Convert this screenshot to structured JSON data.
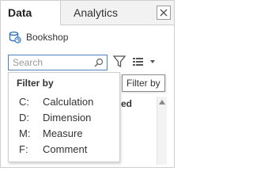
{
  "tabs": {
    "data_label": "Data",
    "analytics_label": "Analytics"
  },
  "datasource": {
    "name": "Bookshop",
    "icon": "database-refresh-icon"
  },
  "search": {
    "placeholder": "Search",
    "value": ""
  },
  "toolbar": {
    "filter_icon": "funnel-icon",
    "view_icon": "list-view-icon"
  },
  "tooltip": {
    "text": "Filter by"
  },
  "filter_menu": {
    "title": "Filter by",
    "items": [
      {
        "key": "C:",
        "label": "Calculation"
      },
      {
        "key": "D:",
        "label": "Dimension"
      },
      {
        "key": "M:",
        "label": "Measure"
      },
      {
        "key": "F:",
        "label": "Comment"
      }
    ]
  },
  "background": {
    "header_fragment": "ed"
  },
  "colors": {
    "accent": "#4f81bd",
    "datasource_icon": "#2a6ebb"
  }
}
